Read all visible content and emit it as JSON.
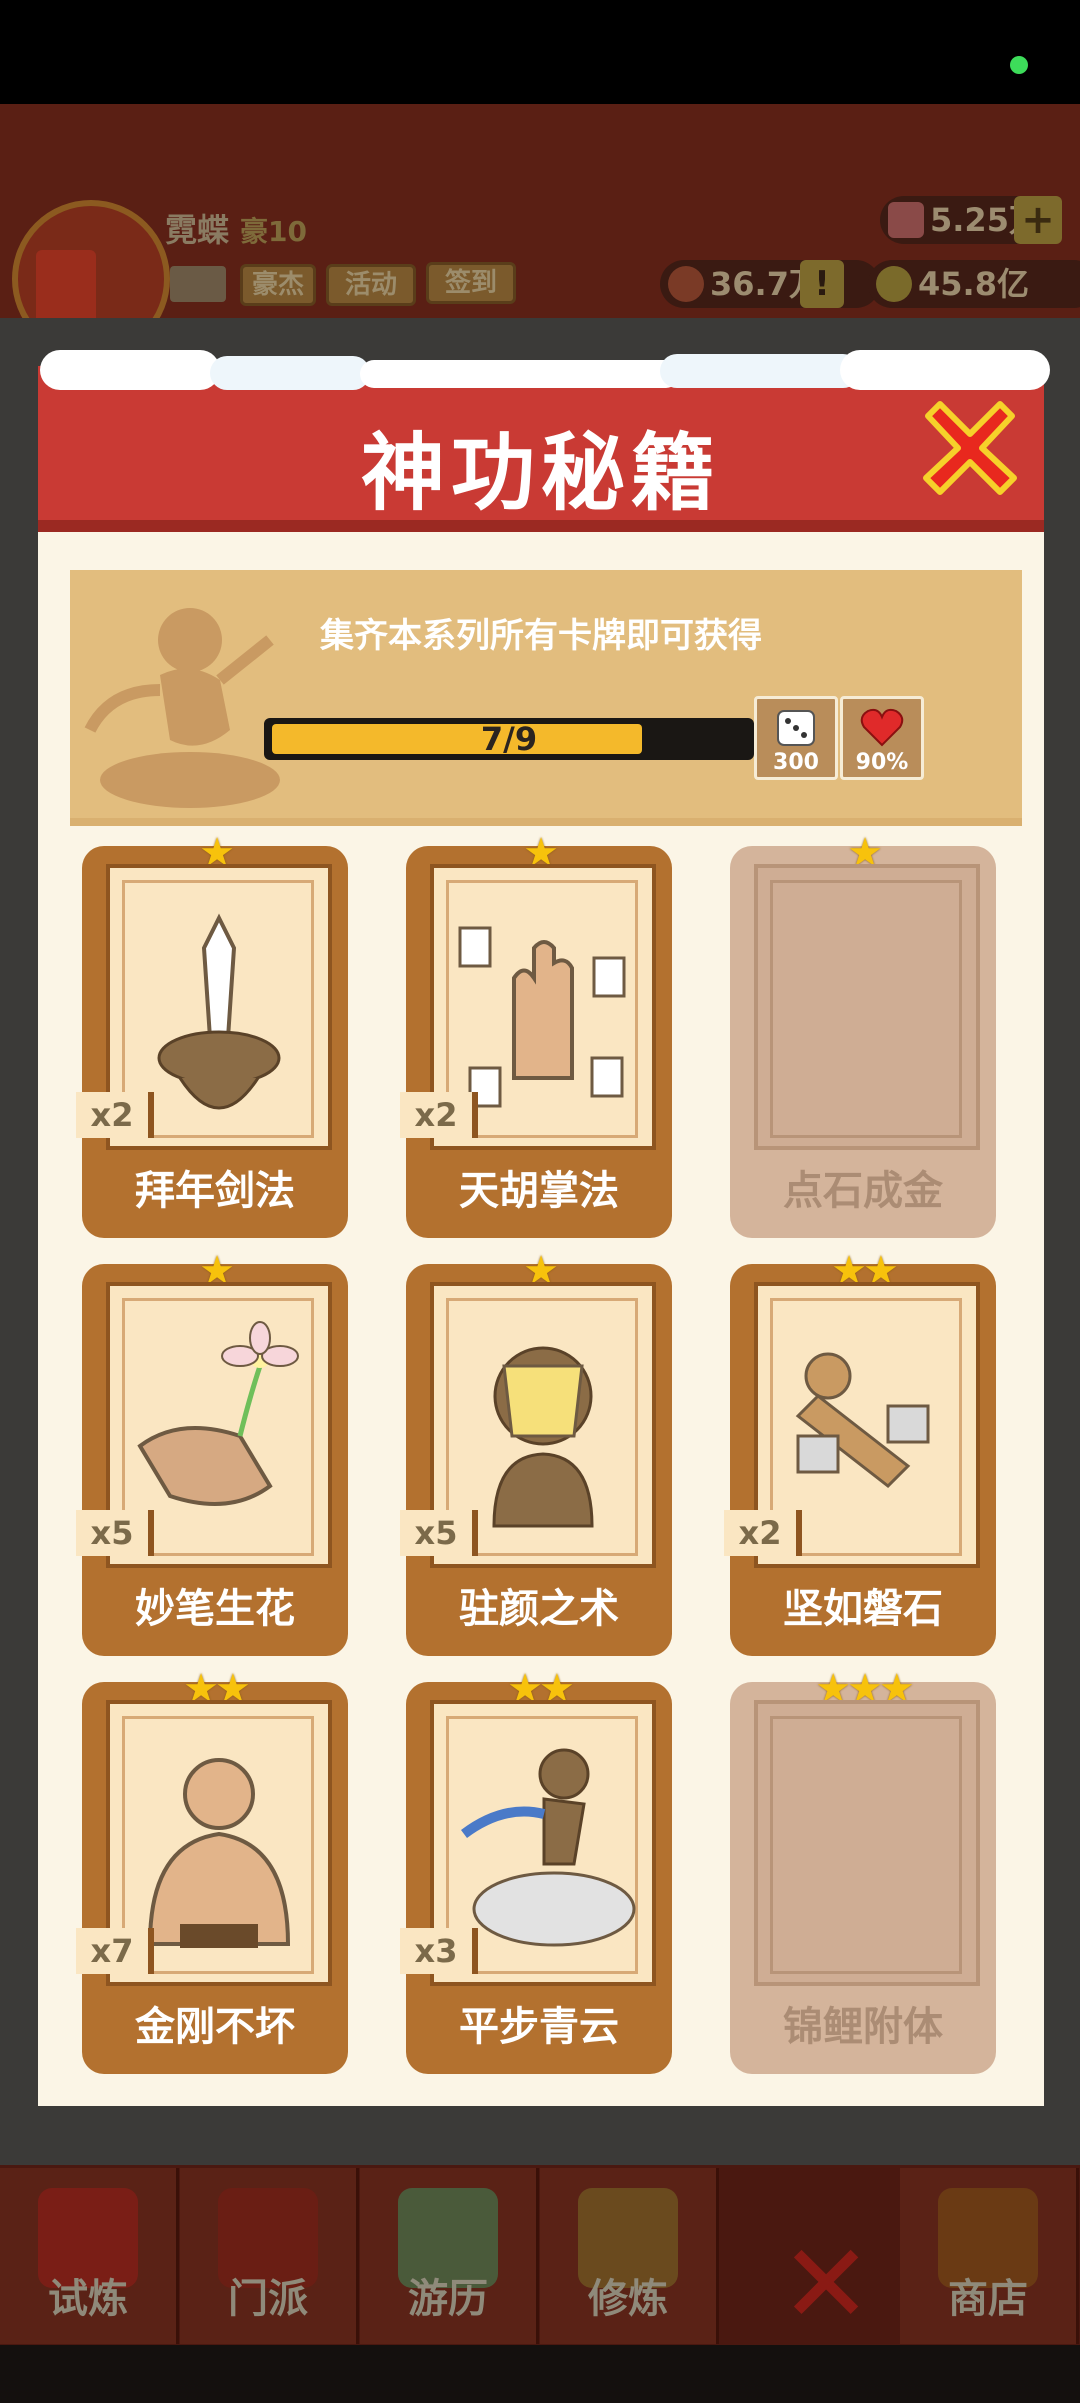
{
  "header": {
    "player_name": "霓蝶",
    "player_rank": "豪10",
    "buttons": {
      "rank": "豪杰",
      "activity": "活动",
      "signin": "签到"
    },
    "resources": {
      "gems": "5.25万",
      "power": "36.7万",
      "gold": "45.8亿"
    },
    "plus": "+",
    "alert": "!"
  },
  "modal": {
    "title": "神功秘籍",
    "banner_text": "集齐本系列所有卡牌即可获得",
    "progress": {
      "text": "7/9",
      "fraction": 0.778
    },
    "rewards": [
      {
        "icon": "dice-icon",
        "label": "300"
      },
      {
        "icon": "heart-icon",
        "label": "90%"
      }
    ]
  },
  "cards": [
    {
      "title": "拜年剑法",
      "count": "x2",
      "stars": "★",
      "owned": true,
      "art": "sword-icon"
    },
    {
      "title": "天胡掌法",
      "count": "x2",
      "stars": "★",
      "owned": true,
      "art": "palm-icon"
    },
    {
      "title": "点石成金",
      "count": "",
      "stars": "★",
      "owned": false,
      "art": ""
    },
    {
      "title": "妙笔生花",
      "count": "x5",
      "stars": "★",
      "owned": true,
      "art": "flower-icon"
    },
    {
      "title": "驻颜之术",
      "count": "x5",
      "stars": "★",
      "owned": true,
      "art": "mask-icon"
    },
    {
      "title": "坚如磐石",
      "count": "x2",
      "stars": "★★",
      "owned": true,
      "art": "stone-figure-icon"
    },
    {
      "title": "金刚不坏",
      "count": "x7",
      "stars": "★★",
      "owned": true,
      "art": "muscle-figure-icon"
    },
    {
      "title": "平步青云",
      "count": "x3",
      "stars": "★★",
      "owned": true,
      "art": "cloud-figure-icon"
    },
    {
      "title": "锦鲤附体",
      "count": "",
      "stars": "★★★",
      "owned": false,
      "art": ""
    }
  ],
  "bottom_nav": [
    {
      "label": "试炼",
      "icon": "firecracker-icon"
    },
    {
      "label": "门派",
      "icon": "gate-icon"
    },
    {
      "label": "游历",
      "icon": "mountain-icon"
    },
    {
      "label": "修炼",
      "icon": "books-icon"
    },
    {
      "label": "",
      "icon": "close-icon"
    },
    {
      "label": "商店",
      "icon": "shop-icon"
    }
  ],
  "colors": {
    "modal_header": "#c93a34",
    "card_brown": "#b3712f",
    "star_gold": "#f7c20c",
    "progress_fill": "#f4b92b"
  }
}
